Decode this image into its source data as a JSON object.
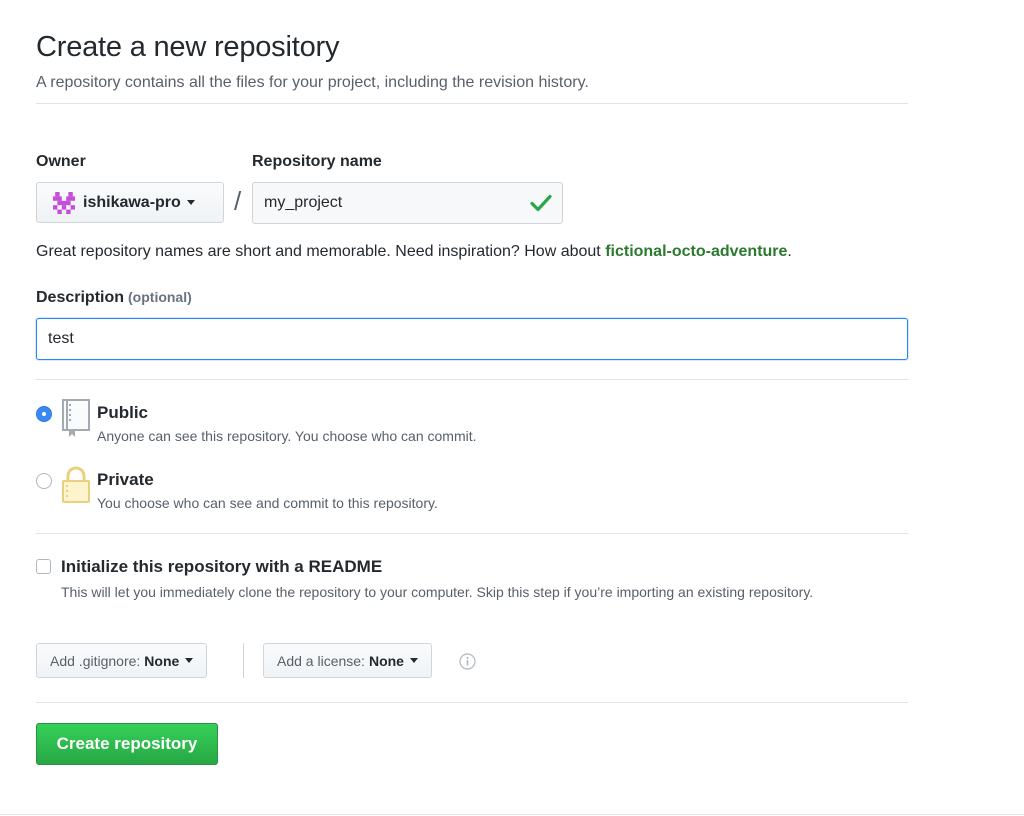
{
  "header": {
    "title": "Create a new repository",
    "subtitle": "A repository contains all the files for your project, including the revision history."
  },
  "owner": {
    "label": "Owner",
    "value": "ishikawa-pro",
    "avatar_icon": "identicon-avatar",
    "avatar_color": "#c54fd8"
  },
  "separator": "/",
  "repository_name": {
    "label": "Repository name",
    "value": "my_project",
    "valid": true,
    "valid_icon": "check-icon",
    "valid_color": "#28a745"
  },
  "name_hint": {
    "text": "Great repository names are short and memorable. Need inspiration? How about ",
    "suggestion": "fictional-octo-adventure",
    "end": "."
  },
  "description": {
    "label": "Description",
    "optional": "(optional)",
    "value": "test"
  },
  "visibility": {
    "selected": "public",
    "options": [
      {
        "id": "public",
        "title": "Public",
        "description": "Anyone can see this repository. You choose who can commit.",
        "icon": "repo-book-icon"
      },
      {
        "id": "private",
        "title": "Private",
        "description": "You choose who can see and commit to this repository.",
        "icon": "lock-icon"
      }
    ]
  },
  "initialize": {
    "checked": false,
    "title": "Initialize this repository with a README",
    "description": "This will let you immediately clone the repository to your computer. Skip this step if you’re importing an existing repository."
  },
  "gitignore": {
    "label": "Add .gitignore:",
    "value": "None"
  },
  "license": {
    "label": "Add a license:",
    "value": "None",
    "info_icon": "info-icon"
  },
  "submit": {
    "label": "Create repository",
    "color": "#28a745"
  }
}
